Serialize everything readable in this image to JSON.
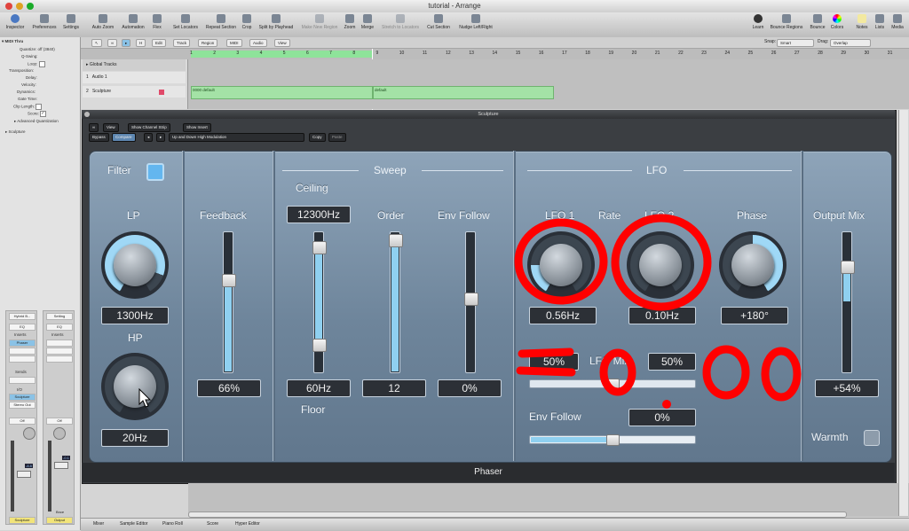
{
  "window": {
    "title": "tutorial - Arrange"
  },
  "toolbar": {
    "buttons": [
      {
        "label": "Inspector"
      },
      {
        "label": "Preferences"
      },
      {
        "label": "Settings"
      },
      {
        "label": "Auto Zoom"
      },
      {
        "label": "Automation"
      },
      {
        "label": "Flex"
      },
      {
        "label": "Set Locators"
      },
      {
        "label": "Repeat Section"
      },
      {
        "label": "Crop"
      },
      {
        "label": "Split by Playhead"
      },
      {
        "label": "Make New Region"
      },
      {
        "label": "Zoom"
      },
      {
        "label": "Merge"
      },
      {
        "label": "Stretch to Locators"
      },
      {
        "label": "Cut Section"
      },
      {
        "label": "Nudge Left/Right"
      }
    ],
    "right_buttons": [
      {
        "label": "Learn"
      },
      {
        "label": "Bounce Regions"
      },
      {
        "label": "Bounce"
      },
      {
        "label": "Colors"
      },
      {
        "label": "Notes"
      },
      {
        "label": "Lists"
      },
      {
        "label": "Media"
      }
    ]
  },
  "inspector": {
    "header": "MIDI Thru",
    "params": [
      {
        "name": "Quantize:",
        "value": "off (3840)"
      },
      {
        "name": "Q-Swing:",
        "value": ""
      },
      {
        "name": "Loop:",
        "value": ""
      },
      {
        "name": "Transposition:",
        "value": ""
      },
      {
        "name": "Delay:",
        "value": ""
      },
      {
        "name": "Velocity:",
        "value": ""
      },
      {
        "name": "Dynamics:",
        "value": ""
      },
      {
        "name": "Gate Time:",
        "value": ""
      },
      {
        "name": "Clip Length:",
        "value": ""
      },
      {
        "name": "Score:",
        "value": ""
      }
    ],
    "advanced": "Advanced Quantization",
    "track": "Sculpture",
    "strip1": {
      "setting": "Hybrid B...",
      "eq": "EQ",
      "inserts": "Inserts",
      "insert1": "Phaser",
      "sends": "Sends",
      "io": "I/O",
      "input": "Sculpture",
      "output": "Stereo Out",
      "mode": "Off",
      "level": "-8.8",
      "name": "Sculpture"
    },
    "strip2": {
      "setting": "Setting",
      "eq": "EQ",
      "inserts": "Inserts",
      "mode": "Off",
      "level": "-0.1",
      "bnce": "Bnce",
      "name": "Output"
    }
  },
  "arrange": {
    "menus": [
      "Edit",
      "Track",
      "Region",
      "MIDI",
      "Audio",
      "View"
    ],
    "snap_label": "Snap:",
    "snap_value": "Smart",
    "drag_label": "Drag:",
    "drag_value": "Overlap",
    "ruler": [
      "1",
      "2",
      "3",
      "4",
      "5",
      "6",
      "7",
      "8",
      "9",
      "10",
      "11",
      "12",
      "13",
      "14",
      "15",
      "16",
      "17",
      "18",
      "19",
      "20",
      "21",
      "22",
      "23",
      "24",
      "25",
      "26",
      "27",
      "28",
      "29",
      "30",
      "31"
    ],
    "global_tracks": "Global Tracks",
    "tracks": [
      {
        "num": "1",
        "name": "Audio 1"
      },
      {
        "num": "2",
        "name": "Sculpture"
      }
    ],
    "regions": [
      {
        "name": "0000 default"
      },
      {
        "name": "default"
      }
    ]
  },
  "plugin": {
    "window_title": "Sculpture",
    "menu_view": "View",
    "menu_channel_strip": "Show Channel Strip",
    "menu_insert": "Show Insert",
    "bypass": "Bypass",
    "compare": "Compare",
    "preset": "Up and Down High Modulation",
    "copy": "Copy",
    "paste": "Paste",
    "name": "Phaser",
    "filter": {
      "label": "Filter",
      "lp_label": "LP",
      "lp_value": "1300Hz",
      "hp_label": "HP",
      "hp_value": "20Hz"
    },
    "feedback": {
      "label": "Feedback",
      "value": "66%",
      "level": 0.66
    },
    "sweep": {
      "header": "Sweep",
      "ceiling_label": "Ceiling",
      "ceiling_value": "12300Hz",
      "floor_label": "Floor",
      "floor_value": "60Hz",
      "order_label": "Order",
      "order_value": "12",
      "env_follow_label": "Env Follow",
      "env_follow_value": "0%"
    },
    "lfo": {
      "header": "LFO",
      "lfo1_label": "LFO 1",
      "rate_label": "Rate",
      "lfo2_label": "LFO 2",
      "lfo1_value": "0.56Hz",
      "lfo2_value": "0.10Hz",
      "phase_label": "Phase",
      "phase_value": "+180°",
      "mix_left": "50%",
      "mix_label": "LFO Mix",
      "mix_right": "50%",
      "env_follow_label": "Env Follow",
      "env_follow_value": "0%"
    },
    "output": {
      "label": "Output Mix",
      "value": "+54%",
      "warmth_label": "Warmth"
    }
  },
  "bottom_tabs": [
    "Mixer",
    "Sample Editor",
    "Piano Roll",
    "Score",
    "Hyper Editor"
  ],
  "annotation": {
    "text": "=0.00",
    "color": "#ff0000"
  }
}
